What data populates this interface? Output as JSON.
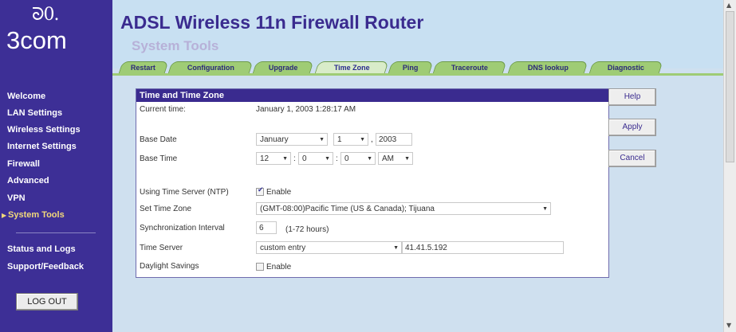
{
  "brand": {
    "mark": "ᘐ0.",
    "name": "3com"
  },
  "sidebar": {
    "items": [
      {
        "label": "Welcome"
      },
      {
        "label": "LAN Settings"
      },
      {
        "label": "Wireless Settings"
      },
      {
        "label": "Internet Settings"
      },
      {
        "label": "Firewall"
      },
      {
        "label": "Advanced"
      },
      {
        "label": "VPN"
      },
      {
        "label": "System Tools"
      },
      {
        "label": "Status and Logs"
      },
      {
        "label": "Support/Feedback"
      }
    ],
    "logout_label": "LOG OUT"
  },
  "header": {
    "title": "ADSL Wireless 11n Firewall Router",
    "subtitle": "System Tools"
  },
  "tabs": [
    {
      "label": "Restart"
    },
    {
      "label": "Configuration"
    },
    {
      "label": "Upgrade"
    },
    {
      "label": "Time Zone"
    },
    {
      "label": "Ping"
    },
    {
      "label": "Traceroute"
    },
    {
      "label": "DNS lookup"
    },
    {
      "label": "Diagnostic"
    }
  ],
  "active_tab": "Time Zone",
  "panel": {
    "title": "Time and Time Zone",
    "current_time_label": "Current time:",
    "current_time_value": "January 1, 2003 1:28:17 AM",
    "base_date_label": "Base Date",
    "base_date": {
      "month": "January",
      "day": "1",
      "year": "2003"
    },
    "base_time_label": "Base Time",
    "base_time": {
      "hour": "12",
      "minute": "0",
      "second": "0",
      "ampm": "AM"
    },
    "ntp_label": "Using Time Server (NTP)",
    "ntp_enable_label": "Enable",
    "ntp_enabled": true,
    "tz_label": "Set Time Zone",
    "tz_value": "(GMT-08:00)Pacific Time (US & Canada); Tijuana",
    "sync_label": "Synchronization Interval",
    "sync_value": "6",
    "sync_hint": "(1-72 hours)",
    "server_label": "Time Server",
    "server_mode": "custom entry",
    "server_value": "41.41.5.192",
    "dst_label": "Daylight Savings",
    "dst_enable_label": "Enable",
    "dst_enabled": false
  },
  "buttons": {
    "help": "Help",
    "apply": "Apply",
    "cancel": "Cancel"
  },
  "colors": {
    "sidebar_bg": "#3d2f96",
    "title": "#3a2b8f",
    "tab_bg": "#9fcc75",
    "content_bg": "#cfe0ef",
    "panel_head": "#3a2b8f"
  }
}
